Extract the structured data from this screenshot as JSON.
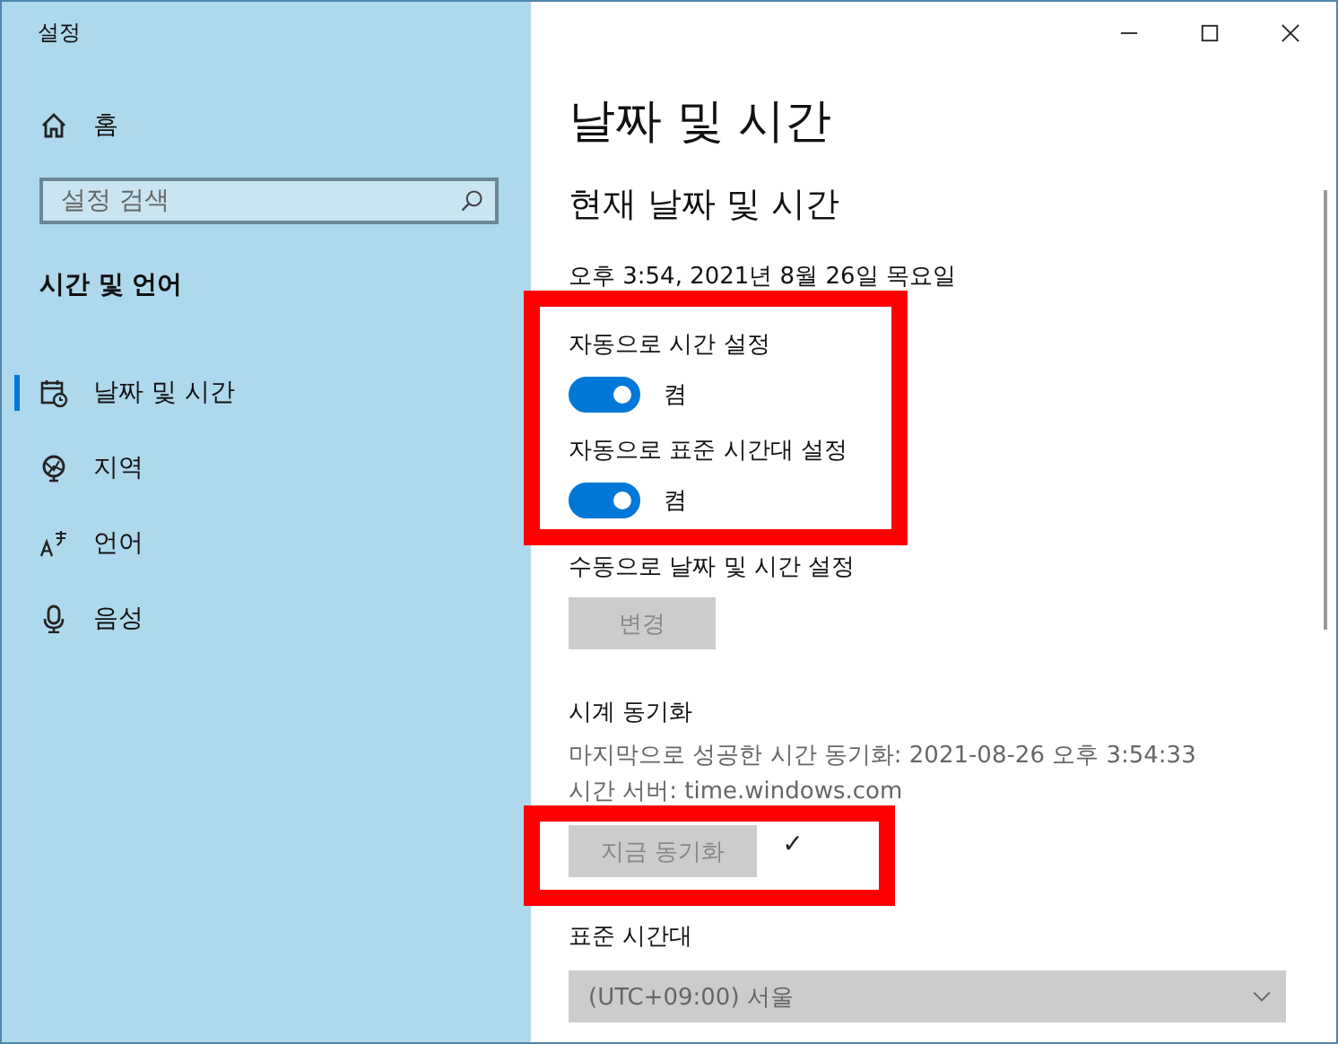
{
  "window": {
    "title": "설정"
  },
  "sidebar": {
    "home": "홈",
    "search": {
      "placeholder": "설정 검색"
    },
    "section": "시간 및 언어",
    "items": [
      {
        "label": "날짜 및 시간",
        "selected": true
      },
      {
        "label": "지역",
        "selected": false
      },
      {
        "label": "언어",
        "selected": false
      },
      {
        "label": "음성",
        "selected": false
      }
    ]
  },
  "content": {
    "title": "날짜 및 시간",
    "heading": "현재 날짜 및 시간",
    "current_time": "오후 3:54, 2021년 8월 26일 목요일",
    "toggles": [
      {
        "label": "자동으로 시간 설정",
        "on": true,
        "state_text": "켬"
      },
      {
        "label": "자동으로 표준 시간대 설정",
        "on": true,
        "state_text": "켬"
      }
    ],
    "manual": {
      "label": "수동으로 날짜 및 시간 설정",
      "button": {
        "label": "변경",
        "disabled": true
      }
    },
    "sync": {
      "heading": "시계 동기화",
      "last_sync": "마지막으로 성공한 시간 동기화: 2021-08-26 오후 3:54:33",
      "server": "시간 서버: time.windows.com",
      "button": {
        "label": "지금 동기화",
        "disabled": true
      },
      "status": "✓"
    },
    "timezone": {
      "heading": "표준 시간대",
      "value": "(UTC+09:00) 서울",
      "disabled": true
    }
  }
}
